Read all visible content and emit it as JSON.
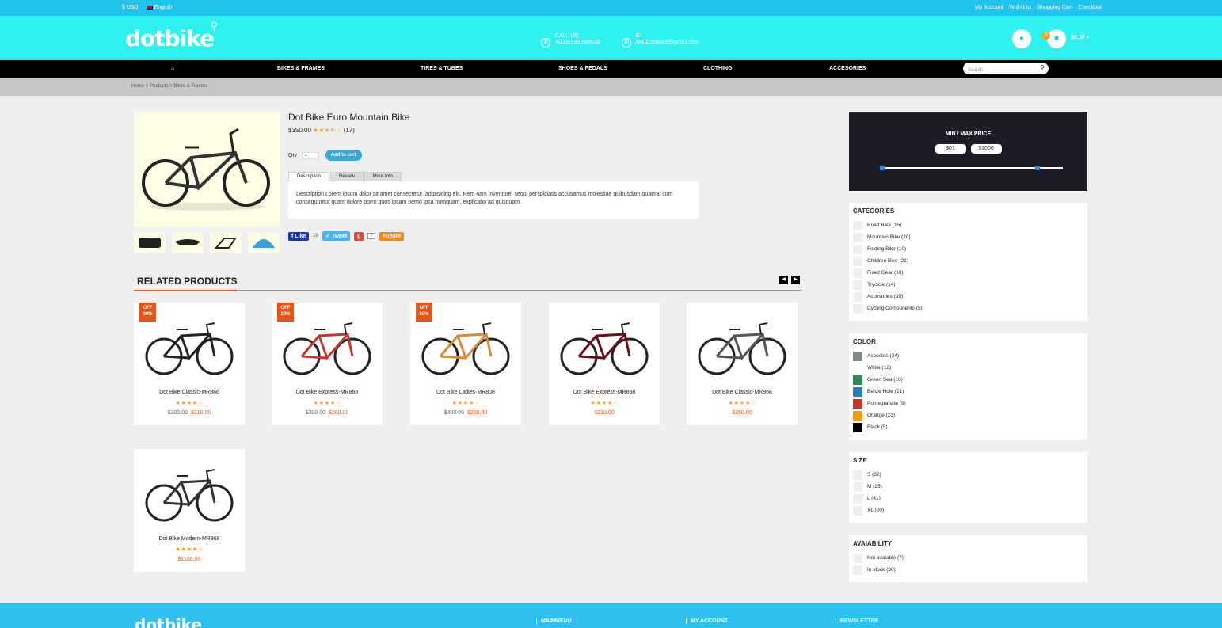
{
  "topbar": {
    "currency": "$ USD",
    "language": "English",
    "links": [
      "My Account",
      "Wish List",
      "Shopping Cart",
      "Checkout"
    ]
  },
  "header": {
    "logo": "dotbike",
    "call_label": "CALL US:",
    "call_number": "+00965888546-32",
    "email_label": "E-",
    "email": "MAIL:dotbike@gmail.com",
    "cart_count": "0",
    "cart_total": "$0.00"
  },
  "nav": {
    "items": [
      "BIKES & FRAMES",
      "TIRES & TUBES",
      "SHOES & PEDALS",
      "CLOTHING",
      "ACCESORIES"
    ],
    "search_placeholder": "Search"
  },
  "breadcrumb": "Home > Products > Bikes & Frames",
  "product": {
    "title": "Dot Bike Euro Mountain Bike",
    "price": "$350.00",
    "rating_stars": "★★★⯪☆",
    "review_count": "(17)",
    "qty_label": "Qty",
    "qty_value": "1",
    "add_to_cart": "Add to cart",
    "tabs": [
      "Description",
      "Review",
      "More Info"
    ],
    "description": "Description Lorem ipsum dolor sit amet consectetur, adipisicing elit. Rem nam inventore, sequi perspiciatis accusamus molestiae quibusdam quaerat cum consequuntur quam dolore porro quos ipsam nemo ipsa numquam, explicabo ad quisquam."
  },
  "social": {
    "like": "Like",
    "like_count": "29",
    "tweet": "Tweet",
    "share": "+Share"
  },
  "related": {
    "title": "RELATED PRODUCTS",
    "items": [
      {
        "name": "Dot Bike Classic-MR866",
        "badge": "OFF 30%",
        "old_price": "$300.00",
        "price": "$210.00",
        "stars": "★★★★☆"
      },
      {
        "name": "Dot Bike Express-MR868",
        "badge": "OFF 20%",
        "old_price": "$300.00",
        "price": "$260.00",
        "stars": "★★★★☆"
      },
      {
        "name": "Dot Bike Ladies-MR808",
        "badge": "OFF 50%",
        "old_price": "$400.00",
        "price": "$200.00",
        "stars": "★★★★☆"
      },
      {
        "name": "Dot Bike Express-MR868",
        "badge": "",
        "old_price": "",
        "price": "$210.00",
        "stars": "★★★★☆"
      },
      {
        "name": "Dot Bike Classic-MR866",
        "badge": "",
        "old_price": "",
        "price": "$350.00",
        "stars": "★★★★☆"
      },
      {
        "name": "Dot Bike Modern-MR868",
        "badge": "",
        "old_price": "",
        "price": "$1100.00",
        "stars": "★★★★☆"
      }
    ]
  },
  "price_filter": {
    "title": "MIN / MAX PRICE",
    "min": "$01",
    "max": "$1000"
  },
  "categories": {
    "title": "CATEGORIES",
    "items": [
      "Road Bike (15)",
      "Mountain Bike (20)",
      "Folding Bike (10)",
      "Children Bike (21)",
      "Fixed Gear (10)",
      "Trycicle (14)",
      "Accesories (35)",
      "Cycling Components (5)"
    ]
  },
  "color": {
    "title": "COLOR",
    "items": [
      {
        "label": "Asbestos (24)",
        "hex": "#7f8c8d"
      },
      {
        "label": "White (12)",
        "hex": "#ffffff"
      },
      {
        "label": "Green Sea (10)",
        "hex": "#2e8b57"
      },
      {
        "label": "Belize Hole (21)",
        "hex": "#2980b9"
      },
      {
        "label": "Pomegranate (9)",
        "hex": "#c0392b"
      },
      {
        "label": "Orange (23)",
        "hex": "#f39c12"
      },
      {
        "label": "Black (5)",
        "hex": "#000000"
      }
    ]
  },
  "size": {
    "title": "SIZE",
    "items": [
      "S (32)",
      "M (25)",
      "L (41)",
      "XL (20)"
    ]
  },
  "availability": {
    "title": "AVAIABILITY",
    "items": [
      "Not avaiable (7)",
      "In stock (30)"
    ]
  },
  "footer": {
    "logo": "dotbike",
    "cols": [
      "MAINMENU",
      "MY ACCOUNT",
      "NEWSLETTER"
    ]
  }
}
